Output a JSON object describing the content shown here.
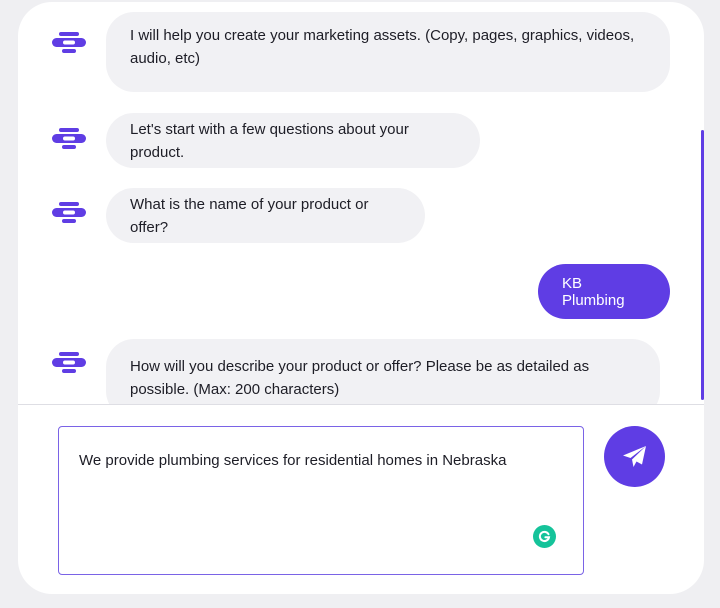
{
  "chat": {
    "messages": [
      {
        "sender": "bot",
        "text": "I will help you create your marketing assets. (Copy, pages, graphics, videos, audio, etc)"
      },
      {
        "sender": "bot",
        "text": "Let's start with a few questions about your product."
      },
      {
        "sender": "bot",
        "text": "What is the name of your product or offer?"
      },
      {
        "sender": "user",
        "text": "KB Plumbing"
      },
      {
        "sender": "bot",
        "text": "How will you describe your product or offer? Please be as detailed as possible. (Max: 200 characters)"
      }
    ]
  },
  "composer": {
    "value": "We provide plumbing services for residential homes in Nebraska",
    "send_icon": "paper-plane-icon",
    "grammarly_icon": "grammarly-icon"
  },
  "colors": {
    "accent": "#5f3de4",
    "bot_bubble": "#f1f1f4",
    "grammarly": "#15c39a"
  }
}
